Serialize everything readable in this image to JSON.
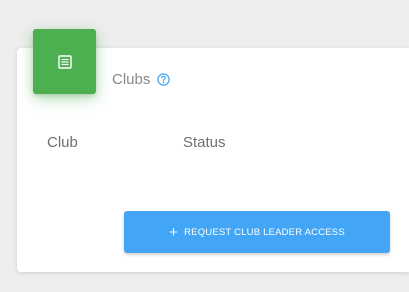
{
  "card": {
    "header_icon": "list-icon",
    "title": "Clubs",
    "help_icon": "help-icon",
    "columns": [
      "Club",
      "Status"
    ]
  },
  "actions": {
    "request_icon": "plus-icon",
    "request_label": "REQUEST CLUB LEADER ACCESS"
  },
  "colors": {
    "header_tile": "#4caf50",
    "primary_button": "#42a5f5",
    "help_icon": "#42a5f5"
  }
}
